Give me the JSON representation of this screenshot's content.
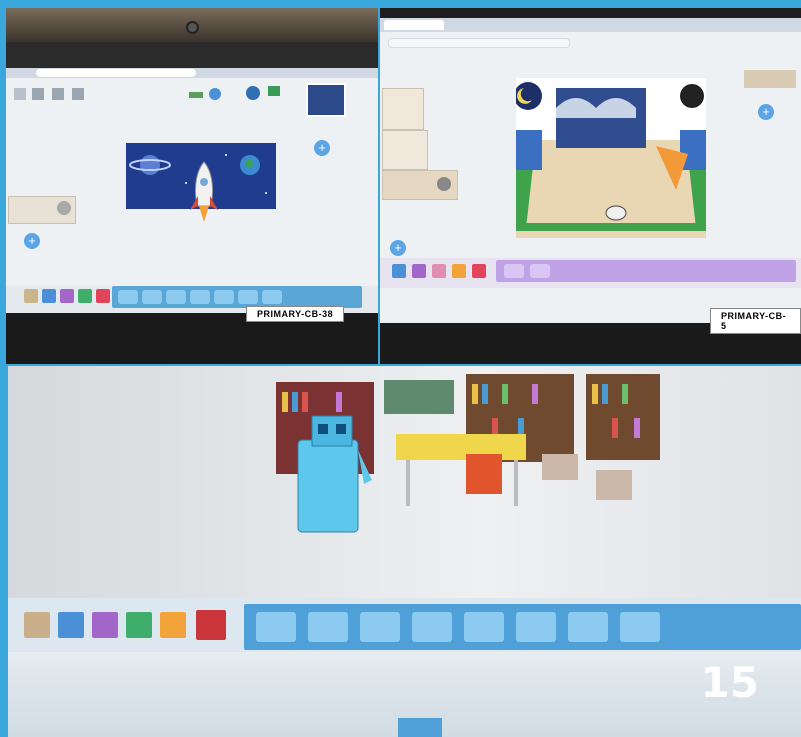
{
  "photos": {
    "top_left": {
      "laptop_label": "PRIMARY-CB-38",
      "scene": "space",
      "icons": [
        "rocket-icon",
        "planet-icon",
        "earth-icon"
      ]
    },
    "top_right": {
      "laptop_label": "PRIMARY-CB-5",
      "scene": "gym",
      "icons": [
        "moon-icon",
        "soccer-ball-icon",
        "popcorn-icon"
      ]
    },
    "bottom": {
      "scene": "library",
      "icons": [
        "bookshelf-icon",
        "robot-icon",
        "chair-icon"
      ]
    }
  },
  "page_number": "15",
  "colors": {
    "frame": "#3aa8dc",
    "block_bar": "#5aa6d6",
    "blocks": "#8ccaf0",
    "page_number": "#ffffff"
  }
}
